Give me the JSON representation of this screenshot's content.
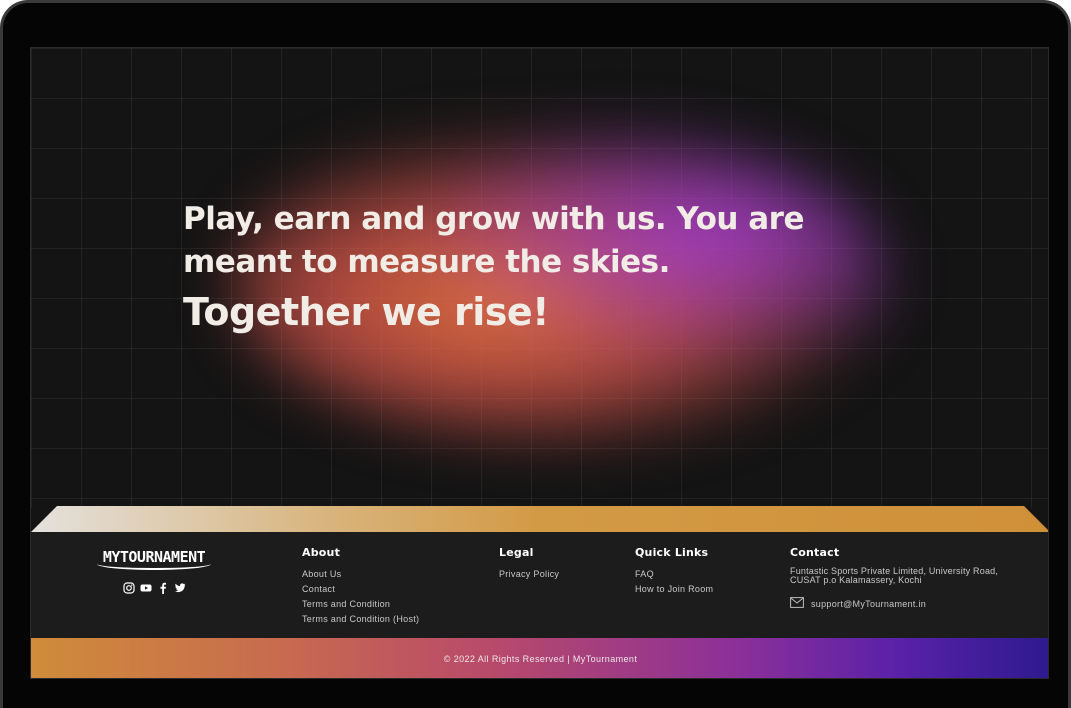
{
  "hero": {
    "line1": "Play, earn and grow with us. You are",
    "line2": "meant to measure the skies.",
    "line3": "Together we rise!"
  },
  "footer": {
    "logo": "MYTOURNAMENT",
    "socials": [
      "instagram-icon",
      "youtube-icon",
      "facebook-icon",
      "twitter-icon"
    ],
    "about": {
      "heading": "About",
      "links": [
        "About Us",
        "Contact",
        "Terms and Condition",
        "Terms and Condition (Host)"
      ]
    },
    "legal": {
      "heading": "Legal",
      "links": [
        "Privacy Policy"
      ]
    },
    "quick_links": {
      "heading": "Quick Links",
      "links": [
        "FAQ",
        "How to Join Room"
      ]
    },
    "contact": {
      "heading": "Contact",
      "address": "Funtastic Sports Private Limited, University Road, CUSAT p.o Kalamassery, Kochi",
      "email": "support@MyTournament.in"
    },
    "copyright": "© 2022 All Rights Reserved | MyTournament"
  },
  "colors": {
    "accent_gold": "#cf9038",
    "accent_purple": "#5a21a8",
    "background": "#141414"
  }
}
